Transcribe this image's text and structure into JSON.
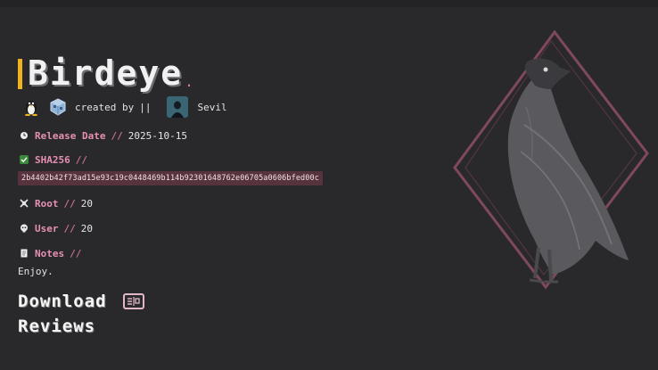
{
  "machine": {
    "title": "Birdeye",
    "created_by_label": "created by",
    "pipes": "||",
    "author": "Sevil"
  },
  "fields": {
    "release": {
      "label": "Release Date",
      "sep": "//",
      "value": "2025-10-15"
    },
    "sha": {
      "label": "SHA256",
      "sep": "//",
      "value": "2b4402b42f73ad15e93c19c0448469b114b92301648762e06705a0606bfed00c"
    },
    "root": {
      "label": "Root",
      "sep": "//",
      "value": "20"
    },
    "user": {
      "label": "User",
      "sep": "//",
      "value": "20"
    },
    "notes": {
      "label": "Notes",
      "sep": "//",
      "value": "Enjoy."
    }
  },
  "actions": {
    "download_label": "Download",
    "reviews_label": "Reviews"
  },
  "icons": {
    "os": "linux-penguin-icon",
    "vm": "virtualbox-icon",
    "download": "book-icon"
  },
  "colors": {
    "accent": "#f0b31d",
    "label": "#e690b3",
    "hash_bg": "#57333e",
    "background": "#29292c"
  }
}
